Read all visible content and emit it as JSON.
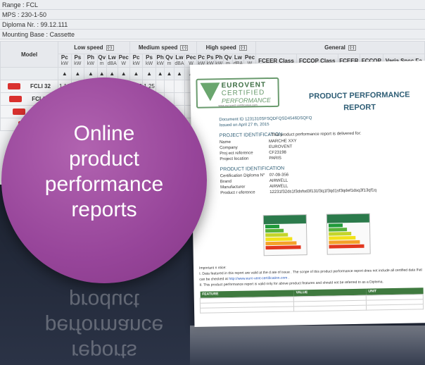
{
  "info": {
    "range": "Range : FCL",
    "mps": "MPS : 230-1-50",
    "diploma": "Diploma Nr. : 99.12.111",
    "mounting": "Mounting Base : Cassette"
  },
  "table": {
    "model_header": "Model",
    "groups": [
      {
        "label": "Low speed",
        "toggle": "(-)"
      },
      {
        "label": "Medium speed",
        "toggle": "(-)"
      },
      {
        "label": "High speed",
        "toggle": "(-)"
      },
      {
        "label": "General",
        "toggle": "(-)"
      }
    ],
    "columns": [
      {
        "name": "Pc",
        "unit": "kW"
      },
      {
        "name": "Ps",
        "unit": "kW"
      },
      {
        "name": "Ph",
        "unit": "kW"
      },
      {
        "name": "Qv",
        "unit": "m"
      },
      {
        "name": "Lw",
        "unit": "dBA"
      },
      {
        "name": "Pec",
        "unit": "W"
      },
      {
        "name": "Pc",
        "unit": "kW"
      },
      {
        "name": "Ps",
        "unit": "kW"
      },
      {
        "name": "Ph",
        "unit": "kW"
      },
      {
        "name": "Qv",
        "unit": "m"
      },
      {
        "name": "Lw",
        "unit": "dBA"
      },
      {
        "name": "Pec",
        "unit": "W"
      },
      {
        "name": "Pc",
        "unit": "kW"
      },
      {
        "name": "Ps",
        "unit": "kW"
      },
      {
        "name": "Ph",
        "unit": "kW"
      },
      {
        "name": "Qv",
        "unit": "m"
      },
      {
        "name": "Lw",
        "unit": "dBA"
      },
      {
        "name": "Pec",
        "unit": "W"
      },
      {
        "name": "FCEER Class",
        "unit": ""
      },
      {
        "name": "FCCOP Class",
        "unit": ""
      },
      {
        "name": "FCEER",
        "unit": ""
      },
      {
        "name": "FCCOP",
        "unit": ""
      },
      {
        "name": "Varia Spec Fa",
        "unit": ""
      }
    ],
    "rows": [
      {
        "model": "FCLI 32",
        "cells": [
          "1,16",
          "0,99",
          "1,33",
          "-",
          "35",
          "10",
          "1,47",
          "1,25"
        ]
      },
      {
        "model": "FCL32",
        "cells": [
          "1,16",
          "0,99",
          "1,33",
          "-",
          "35",
          "21",
          "1,47",
          "1,25"
        ]
      },
      {
        "model": "FCL",
        "cells": [
          "",
          "",
          "",
          "",
          "",
          "21",
          "2,25",
          "1,78"
        ]
      },
      {
        "model": "",
        "cells": [
          "",
          "",
          "",
          "",
          "",
          "",
          "1,82",
          ""
        ]
      }
    ]
  },
  "promo": {
    "lines": [
      "Online",
      "product",
      "performance",
      "reports"
    ]
  },
  "report": {
    "logo_line1": "EUROVENT",
    "logo_line2": "CERTIFIED",
    "logo_line3": "PERFORMANCE",
    "logo_url": "www.eurovent-certification.com",
    "title": "PRODUCT PERFORMANCE REPORT",
    "doc_id": "Document ID  1231310SFSQDFQSD4546DSQFQ",
    "issued": "Issued on   April 27 th, 2015",
    "project_heading": "PROJECT IDENTIFICATION",
    "project_intro": "- This  product performance report  is delivered for:",
    "project": [
      {
        "k": "Name",
        "v": "MARCHE XXY"
      },
      {
        "k": "Company",
        "v": "EUROVENT"
      },
      {
        "k": "Proj ect reference",
        "v": "CF23198"
      },
      {
        "k": "Project location",
        "v": "PARIS"
      }
    ],
    "product_heading": "PRODUCT IDENTIFICATION",
    "product": [
      {
        "k": "Certification  Diploma N°",
        "v": "07-09-356"
      },
      {
        "k": "Brand",
        "v": "AIRWELL"
      },
      {
        "k": "Manufacturer",
        "v": "AIRWELL"
      },
      {
        "k": "Product r eference",
        "v": "12231f32ds1f3dsfsd3f131f3q1f3qd1sf3qdef1dsq3f13qf1q"
      }
    ],
    "notice_heading": "Important n otice:",
    "notice_1": "I.    Data featured in this report  are  valid at the d ate of issue . The scope of this product performance report does not include all certified data that can be checked at",
    "notice_link": "http://www.euro vent-certification.com .",
    "notice_2": "II.    This  product performance report  is valid only for above product features and should not be referred         to as a Diploma.",
    "feature_headers": [
      "FEATURE",
      "VALUE",
      "UNIT"
    ]
  },
  "colors": {
    "purple": "#97459a",
    "eurovent_green": "#3d6e43",
    "report_blue": "#2e5d75",
    "button_red": "#d9312f"
  }
}
